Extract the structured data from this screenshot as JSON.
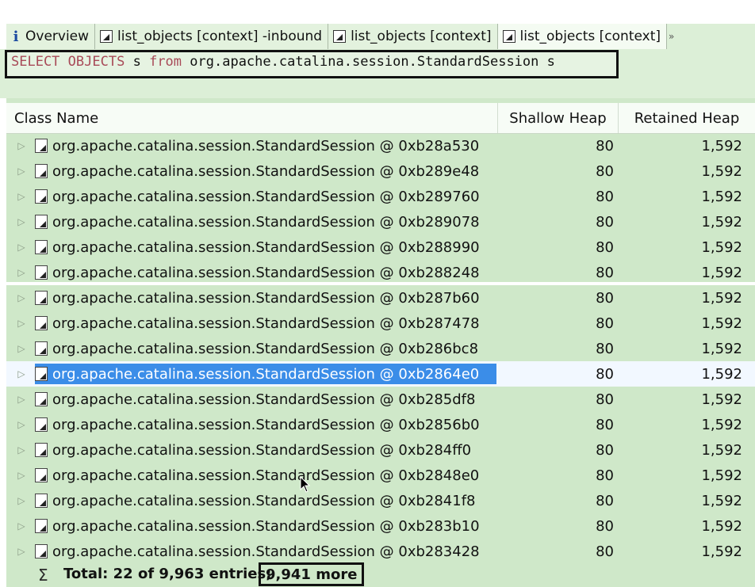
{
  "tabs": [
    {
      "label": "Overview",
      "icon": "info-icon",
      "active": false
    },
    {
      "label": "list_objects [context] -inbound",
      "icon": "document-icon",
      "active": false
    },
    {
      "label": "list_objects [context]",
      "icon": "document-icon",
      "active": false
    },
    {
      "label": "list_objects [context]",
      "icon": "document-icon",
      "active": true
    }
  ],
  "query": {
    "kw1": "SELECT",
    "kw2": "OBJECTS",
    "alias1": "s",
    "kw3": "from",
    "class": "org.apache.catalina.session.StandardSession",
    "alias2": "s"
  },
  "table": {
    "columns": [
      "Class Name",
      "Shallow Heap",
      "Retained Heap"
    ],
    "rows": [
      {
        "name": "org.apache.catalina.session.StandardSession @ 0xb28a530",
        "shallow": "80",
        "retained": "1,592"
      },
      {
        "name": "org.apache.catalina.session.StandardSession @ 0xb289e48",
        "shallow": "80",
        "retained": "1,592"
      },
      {
        "name": "org.apache.catalina.session.StandardSession @ 0xb289760",
        "shallow": "80",
        "retained": "1,592"
      },
      {
        "name": "org.apache.catalina.session.StandardSession @ 0xb289078",
        "shallow": "80",
        "retained": "1,592"
      },
      {
        "name": "org.apache.catalina.session.StandardSession @ 0xb288990",
        "shallow": "80",
        "retained": "1,592"
      },
      {
        "name": "org.apache.catalina.session.StandardSession @ 0xb288248",
        "shallow": "80",
        "retained": "1,592"
      },
      {
        "name": "org.apache.catalina.session.StandardSession @ 0xb287b60",
        "shallow": "80",
        "retained": "1,592"
      },
      {
        "name": "org.apache.catalina.session.StandardSession @ 0xb287478",
        "shallow": "80",
        "retained": "1,592"
      },
      {
        "name": "org.apache.catalina.session.StandardSession @ 0xb286bc8",
        "shallow": "80",
        "retained": "1,592"
      },
      {
        "name": "org.apache.catalina.session.StandardSession @ 0xb2864e0",
        "shallow": "80",
        "retained": "1,592",
        "selected": true
      },
      {
        "name": "org.apache.catalina.session.StandardSession @ 0xb285df8",
        "shallow": "80",
        "retained": "1,592"
      },
      {
        "name": "org.apache.catalina.session.StandardSession @ 0xb2856b0",
        "shallow": "80",
        "retained": "1,592"
      },
      {
        "name": "org.apache.catalina.session.StandardSession @ 0xb284ff0",
        "shallow": "80",
        "retained": "1,592"
      },
      {
        "name": "org.apache.catalina.session.StandardSession @ 0xb2848e0",
        "shallow": "80",
        "retained": "1,592"
      },
      {
        "name": "org.apache.catalina.session.StandardSession @ 0xb2841f8",
        "shallow": "80",
        "retained": "1,592"
      },
      {
        "name": "org.apache.catalina.session.StandardSession @ 0xb283b10",
        "shallow": "80",
        "retained": "1,592"
      },
      {
        "name": "org.apache.catalina.session.StandardSession @ 0xb283428",
        "shallow": "80",
        "retained": "1,592"
      }
    ],
    "total_text": "Total: 22 of 9,963 entries;",
    "more_text": "9,941 more"
  },
  "colors": {
    "panel_bg": "#cfe8c9",
    "selection": "#3b8de8",
    "keyword": "#a84a58"
  }
}
